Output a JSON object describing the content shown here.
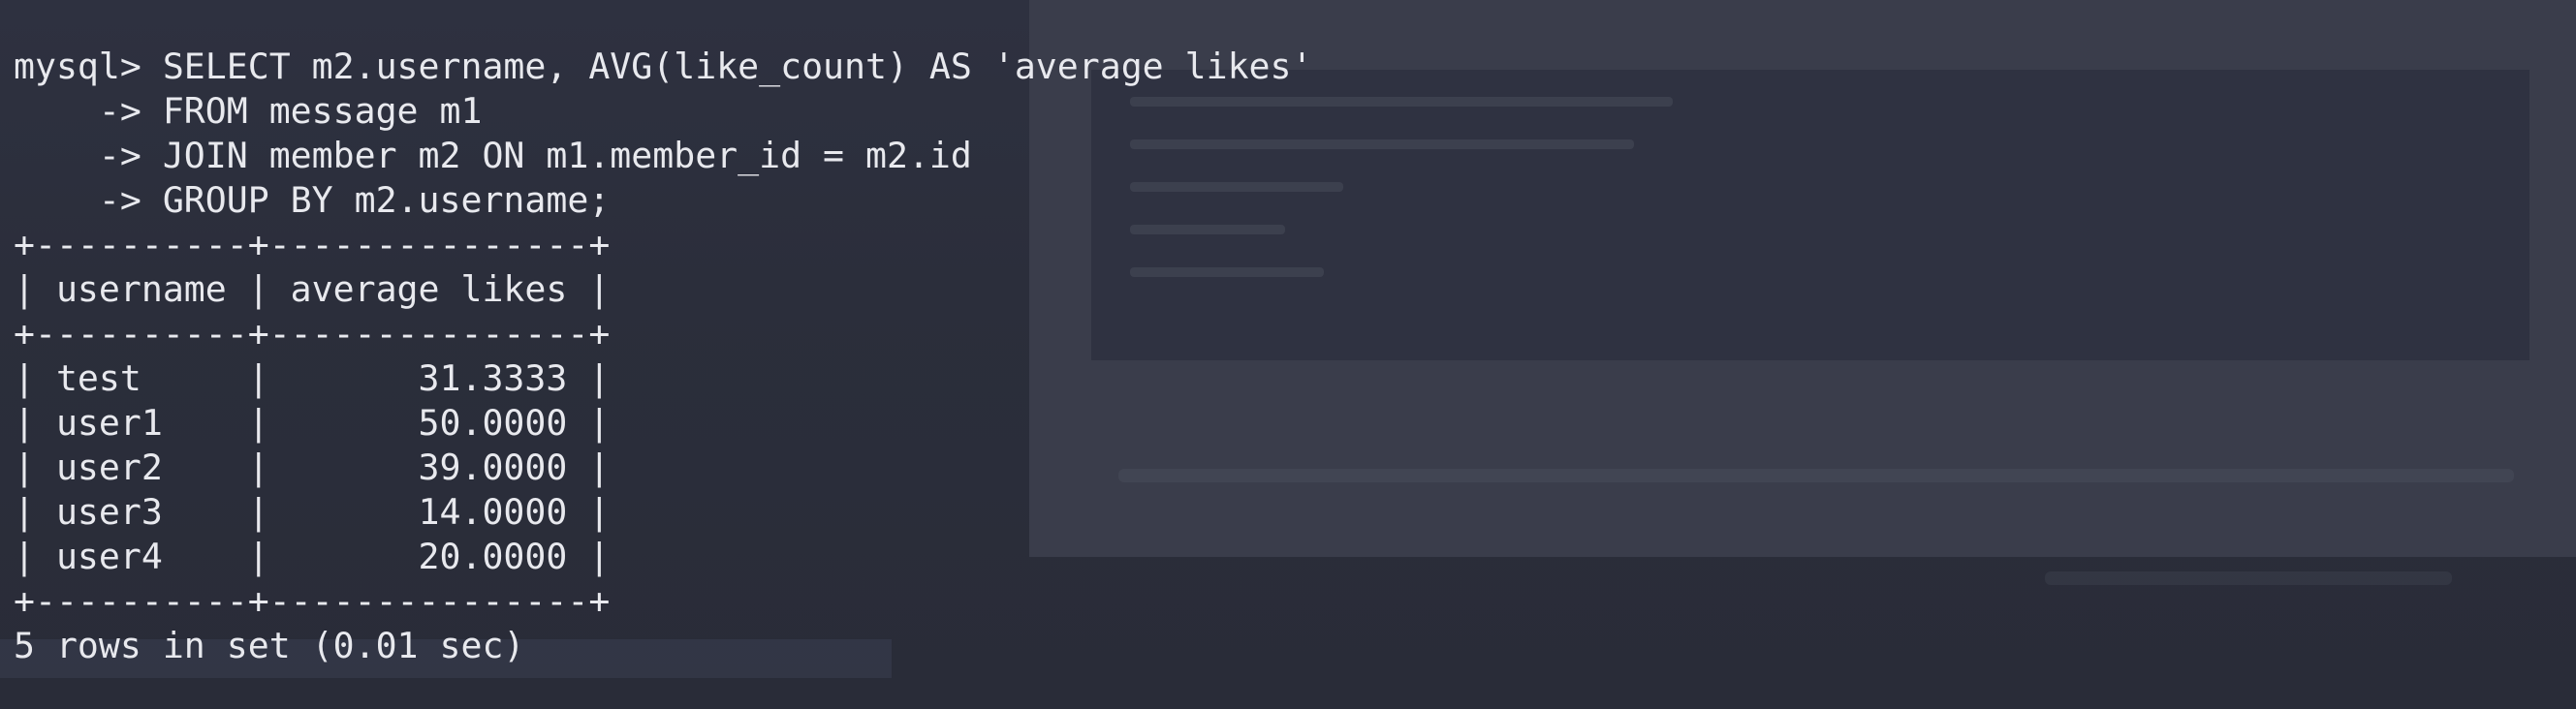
{
  "terminal": {
    "lines": [
      "mysql> SELECT m2.username, AVG(like_count) AS 'average likes'",
      "    -> FROM message m1",
      "    -> JOIN member m2 ON m1.member_id = m2.id",
      "    -> GROUP BY m2.username;",
      "+----------+---------------+",
      "| username | average likes |",
      "+----------+---------------+",
      "| test     |       31.3333 |",
      "| user1    |       50.0000 |",
      "| user2    |       39.0000 |",
      "| user3    |       14.0000 |",
      "| user4    |       20.0000 |",
      "+----------+---------------+",
      "5 rows in set (0.01 sec)"
    ]
  }
}
